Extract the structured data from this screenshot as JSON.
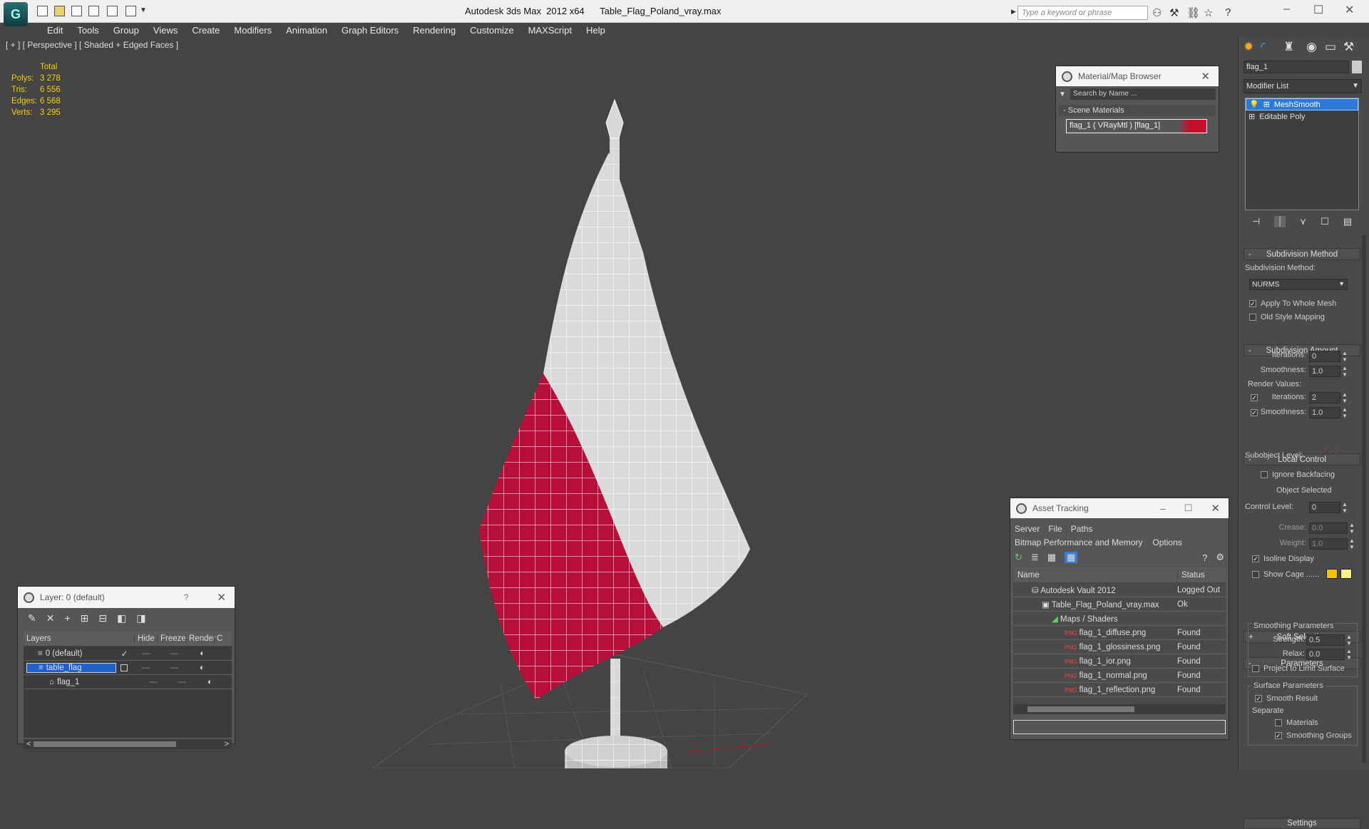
{
  "window": {
    "title_app": "Autodesk 3ds Max  2012 x64",
    "title_file": "Table_Flag_Poland_vray.max",
    "search_placeholder": "Type a keyword or phrase",
    "minimize": "–",
    "maximize": "☐",
    "close": "✕"
  },
  "menu": [
    "Edit",
    "Tools",
    "Group",
    "Views",
    "Create",
    "Modifiers",
    "Animation",
    "Graph Editors",
    "Rendering",
    "Customize",
    "MAXScript",
    "Help"
  ],
  "viewport": {
    "label": "[ + ] [ Perspective ] [ Shaded + Edged Faces ]",
    "stats": {
      "header": "Total",
      "polys_label": "Polys:",
      "polys": "3 278",
      "tris_label": "Tris:",
      "tris": "6 556",
      "edges_label": "Edges:",
      "edges": "6 568",
      "verts_label": "Verts:",
      "verts": "3 295"
    }
  },
  "material_browser": {
    "title": "Material/Map Browser",
    "search_placeholder": "Search by Name ...",
    "section": "Scene Materials",
    "item": "flag_1  ( VRayMtl )  [flag_1]",
    "item_color": "#c8102e"
  },
  "layer_panel": {
    "title": "Layer: 0 (default)",
    "help": "?",
    "columns": [
      "Layers",
      "Hide",
      "Freeze",
      "Render",
      "C"
    ],
    "rows": [
      {
        "name": "0 (default)"
      },
      {
        "name": "table_flag"
      },
      {
        "name": "flag_1"
      }
    ],
    "scroll_left": "<",
    "scroll_right": ">"
  },
  "asset_tracking": {
    "title": "Asset Tracking",
    "menu": [
      "Server",
      "File",
      "Paths"
    ],
    "menu2": [
      "Bitmap Performance and Memory",
      "Options"
    ],
    "columns": [
      "Name",
      "Status"
    ],
    "rows": [
      {
        "name": "Autodesk Vault 2012",
        "status": "Logged Out"
      },
      {
        "name": "Table_Flag_Poland_vray.max",
        "status": "Ok"
      },
      {
        "name": "Maps / Shaders",
        "status": ""
      },
      {
        "name": "flag_1_diffuse.png",
        "status": "Found"
      },
      {
        "name": "flag_1_glossiness.png",
        "status": "Found"
      },
      {
        "name": "flag_1_ior.png",
        "status": "Found"
      },
      {
        "name": "flag_1_normal.png",
        "status": "Found"
      },
      {
        "name": "flag_1_reflection.png",
        "status": "Found"
      }
    ],
    "png_tag": "PNG"
  },
  "right_panel": {
    "object_name": "flag_1",
    "modifier_list": "Modifier List",
    "stack": [
      "MeshSmooth",
      "Editable Poly"
    ],
    "subdivision_method": {
      "header": "Subdivision Method",
      "label": "Subdivision Method:",
      "value": "NURMS",
      "apply_whole_mesh": "Apply To Whole Mesh",
      "old_style_mapping": "Old Style Mapping"
    },
    "subdivision_amount": {
      "header": "Subdivision Amount",
      "iterations_label": "Iterations:",
      "iterations": "0",
      "smoothness_label": "Smoothness:",
      "smoothness": "1.0",
      "render_values": "Render Values:",
      "r_iterations_label": "Iterations:",
      "r_iterations": "2",
      "r_smoothness_label": "Smoothness:",
      "r_smoothness": "1.0"
    },
    "local_control": {
      "header": "Local Control",
      "subobject_level": "Subobject Level:",
      "ignore_backfacing": "Ignore Backfacing",
      "object_selected": "Object Selected",
      "control_level_label": "Control Level:",
      "control_level": "0",
      "crease_label": "Crease:",
      "crease": "0.0",
      "weight_label": "Weight:",
      "weight": "1.0",
      "isoline_display": "Isoline Display",
      "show_cage": "Show Cage ......"
    },
    "soft_selection": "Soft Selection",
    "parameters": {
      "header": "Parameters",
      "smoothing_parameters": "Smoothing Parameters",
      "strength_label": "Strength:",
      "strength": "0.5",
      "relax_label": "Relax:",
      "relax": "0.0",
      "project_to_limit": "Project to Limit Surface",
      "surface_parameters": "Surface Parameters",
      "smooth_result": "Smooth Result",
      "separate": "Separate",
      "materials": "Materials",
      "smoothing_groups": "Smoothing Groups"
    },
    "settings": "Settings"
  },
  "colors": {
    "flag_red": "#b80f3a",
    "flag_white": "#dadada",
    "cage_yellow": "#f5c400"
  }
}
